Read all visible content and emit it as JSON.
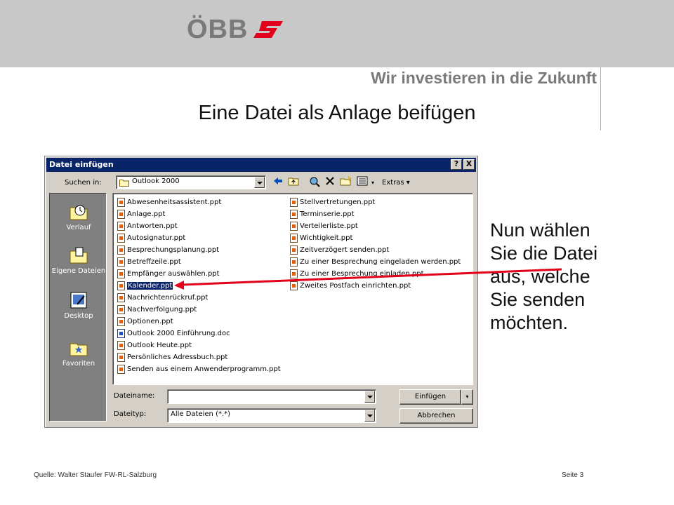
{
  "brand": {
    "logo_text": "ÖBB",
    "tagline": "Wir investieren in die Zukunft",
    "accent": "#e2001a",
    "logo_gray": "#7a7a7a"
  },
  "slide": {
    "title": "Eine Datei als Anlage beifügen",
    "callout": [
      "Nun wählen",
      "Sie die Datei",
      "aus, welche",
      "Sie senden",
      "möchten."
    ]
  },
  "dialog": {
    "title": "Datei einfügen",
    "help_label": "?",
    "close_label": "X",
    "look_in_label": "Suchen in:",
    "look_in_value": "Outlook 2000",
    "extras_label": "Extras",
    "toolbar_icons": [
      "back-icon",
      "up-folder-icon",
      "search-web-icon",
      "delete-icon",
      "new-folder-icon",
      "views-icon"
    ],
    "places": [
      {
        "label": "Verlauf",
        "icon": "history-icon"
      },
      {
        "label": "Eigene Dateien",
        "icon": "my-documents-icon"
      },
      {
        "label": "Desktop",
        "icon": "desktop-icon"
      },
      {
        "label": "Favoriten",
        "icon": "favorites-icon"
      }
    ],
    "files_left": [
      {
        "name": "Abwesenheitsassistent.ppt",
        "type": "ppt"
      },
      {
        "name": "Anlage.ppt",
        "type": "ppt"
      },
      {
        "name": "Antworten.ppt",
        "type": "ppt"
      },
      {
        "name": "Autosignatur.ppt",
        "type": "ppt"
      },
      {
        "name": "Besprechungsplanung.ppt",
        "type": "ppt"
      },
      {
        "name": "Betreffzeile.ppt",
        "type": "ppt"
      },
      {
        "name": "Empfänger auswählen.ppt",
        "type": "ppt"
      },
      {
        "name": "Kalender.ppt",
        "type": "ppt",
        "selected": true
      },
      {
        "name": "Nachrichtenrückruf.ppt",
        "type": "ppt"
      },
      {
        "name": "Nachverfolgung.ppt",
        "type": "ppt"
      },
      {
        "name": "Optionen.ppt",
        "type": "ppt"
      },
      {
        "name": "Outlook 2000 Einführung.doc",
        "type": "doc"
      },
      {
        "name": "Outlook Heute.ppt",
        "type": "ppt"
      },
      {
        "name": "Persönliches Adressbuch.ppt",
        "type": "ppt"
      },
      {
        "name": "Senden aus einem Anwenderprogramm.ppt",
        "type": "ppt"
      }
    ],
    "files_right": [
      {
        "name": "Stellvertretungen.ppt",
        "type": "ppt"
      },
      {
        "name": "Terminserie.ppt",
        "type": "ppt"
      },
      {
        "name": "Verteilerliste.ppt",
        "type": "ppt"
      },
      {
        "name": "Wichtigkeit.ppt",
        "type": "ppt"
      },
      {
        "name": "Zeitverzögert senden.ppt",
        "type": "ppt"
      },
      {
        "name": "Zu einer Besprechung eingeladen werden.ppt",
        "type": "ppt"
      },
      {
        "name": "Zu einer Besprechung einladen.ppt",
        "type": "ppt"
      },
      {
        "name": "Zweites Postfach einrichten.ppt",
        "type": "ppt"
      }
    ],
    "filename_label": "Dateiname:",
    "filename_value": "",
    "filetype_label": "Dateityp:",
    "filetype_value": "Alle Dateien (*.*)",
    "insert_label": "Einfügen",
    "cancel_label": "Abbrechen"
  },
  "footer": {
    "source": "Quelle: Walter Staufer FW-RL-Salzburg",
    "page": "Seite 3"
  }
}
